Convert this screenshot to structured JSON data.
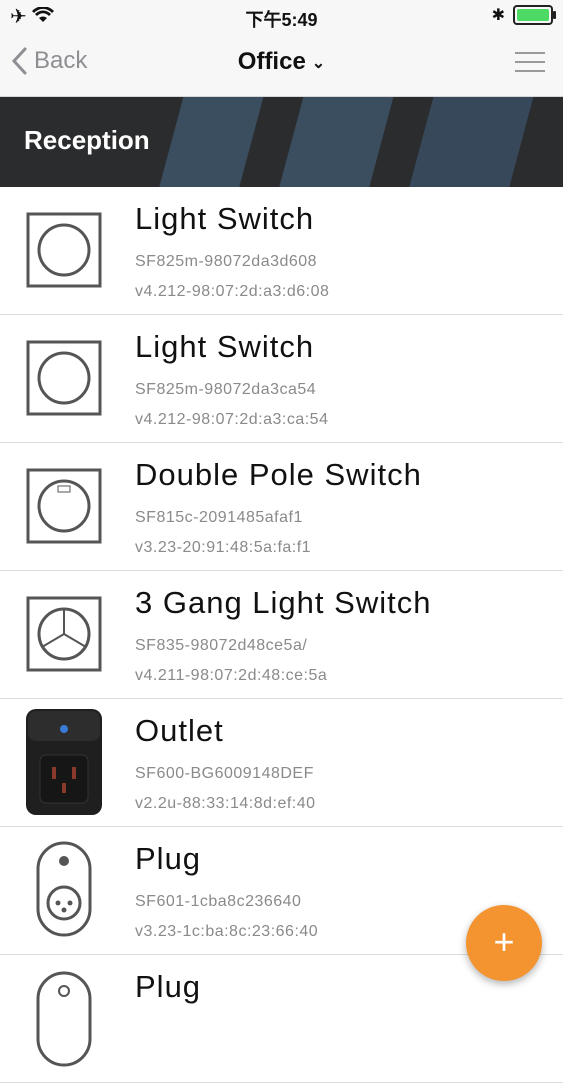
{
  "status_bar": {
    "time": "下午5:49"
  },
  "nav": {
    "back_label": "Back",
    "title": "Office",
    "menu_icon": "hamburger-icon"
  },
  "section": {
    "title": "Reception"
  },
  "devices": [
    {
      "name": "Light Switch",
      "id": "SF825m-98072da3d608",
      "version": "v4.212-98:07:2d:a3:d6:08",
      "icon": "light-switch-icon"
    },
    {
      "name": "Light Switch",
      "id": "SF825m-98072da3ca54",
      "version": "v4.212-98:07:2d:a3:ca:54",
      "icon": "light-switch-icon"
    },
    {
      "name": "Double Pole Switch",
      "id": "SF815c-2091485afaf1",
      "version": "v3.23-20:91:48:5a:fa:f1",
      "icon": "double-pole-switch-icon"
    },
    {
      "name": "3 Gang Light Switch",
      "id": "SF835-98072d48ce5a/",
      "version": "v4.211-98:07:2d:48:ce:5a",
      "icon": "three-gang-switch-icon"
    },
    {
      "name": "Outlet",
      "id": "SF600-BG6009148DEF",
      "version": "v2.2u-88:33:14:8d:ef:40",
      "icon": "outlet-icon"
    },
    {
      "name": "Plug",
      "id": "SF601-1cba8c236640",
      "version": "v3.23-1c:ba:8c:23:66:40",
      "icon": "plug-icon"
    },
    {
      "name": "Plug",
      "id": "",
      "version": "",
      "icon": "plug-icon"
    }
  ],
  "fab": {
    "label": "+"
  },
  "colors": {
    "accent": "#f39431",
    "section_bg": "#2b2c2e"
  }
}
